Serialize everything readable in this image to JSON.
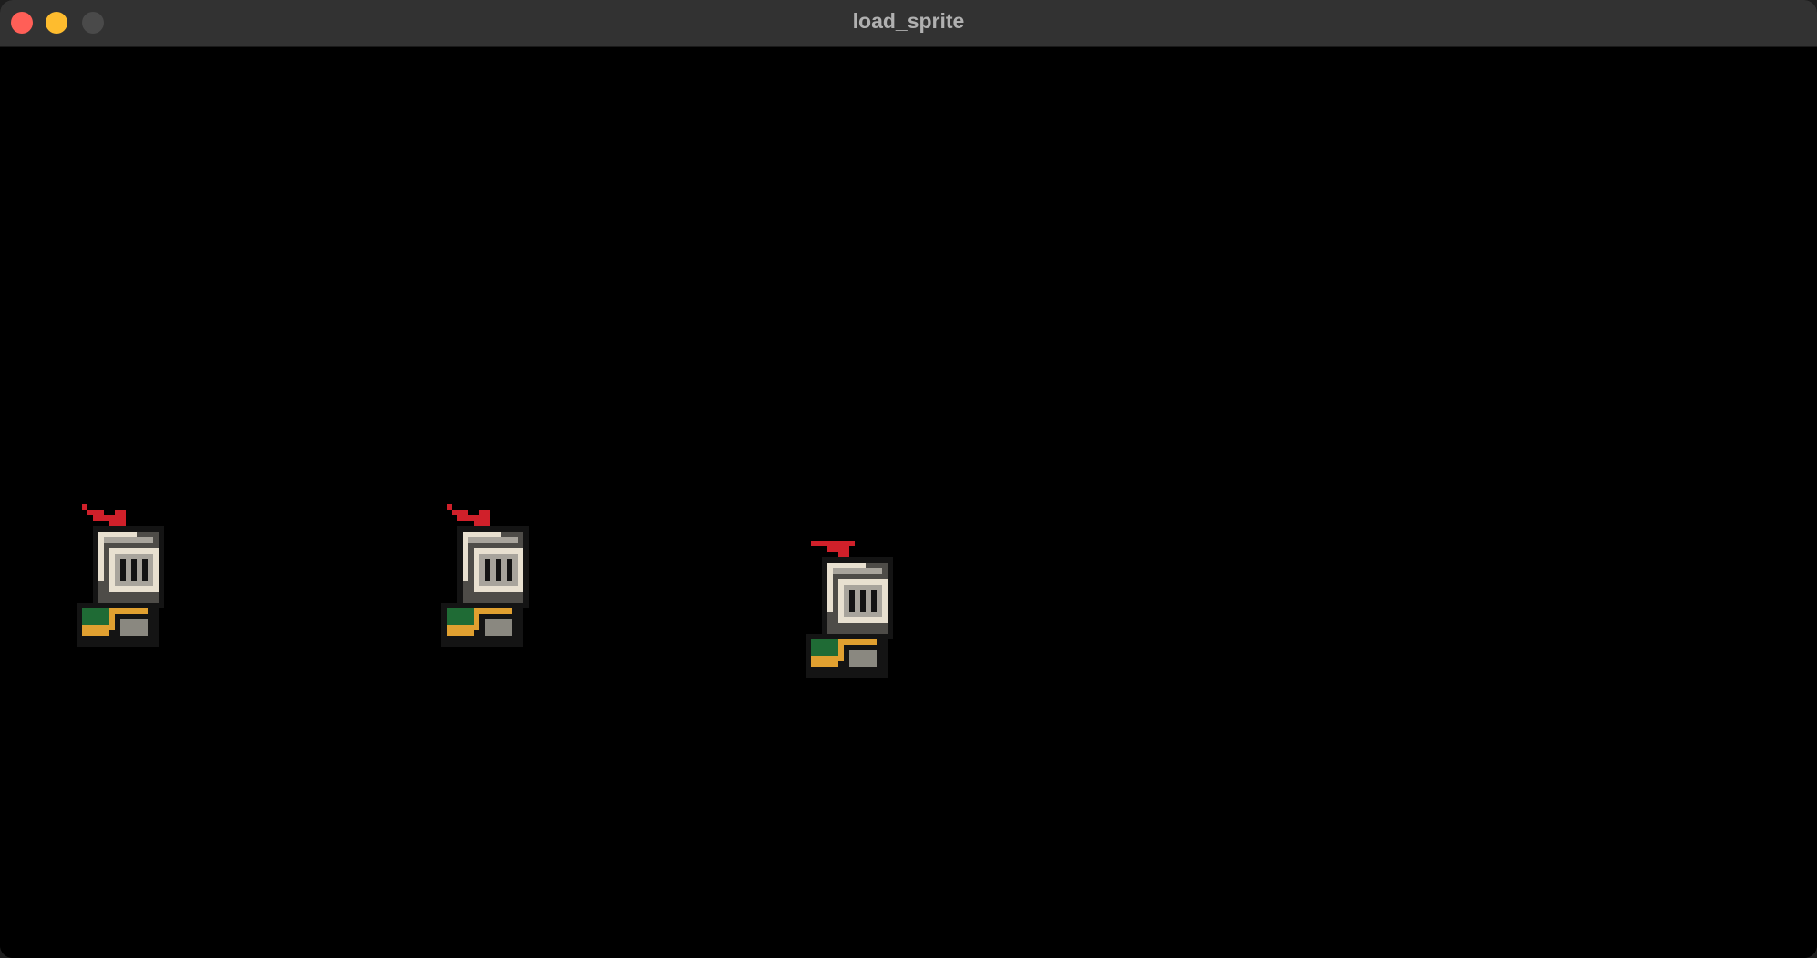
{
  "window": {
    "title": "load_sprite",
    "traffic_lights": {
      "close_color": "#ff5f57",
      "minimize_color": "#febc2e",
      "maximize_color": "#4a4a4a"
    }
  },
  "canvas": {
    "background": "#000000",
    "sprites": [
      {
        "name": "knight",
        "pose": "helmet-up"
      },
      {
        "name": "knight",
        "pose": "helmet-up"
      },
      {
        "name": "knight",
        "pose": "helmet-down"
      }
    ]
  },
  "palette": {
    "plume": "#d0202a",
    "helmet_light": "#e8e0d0",
    "helmet_mid": "#a8a49c",
    "helmet_dark": "#4e4c48",
    "visor_slot": "#141414",
    "outline": "#141414",
    "boot_green": "#1f6b35",
    "boot_gold": "#e0a030",
    "boot_grey": "#8a8880"
  }
}
